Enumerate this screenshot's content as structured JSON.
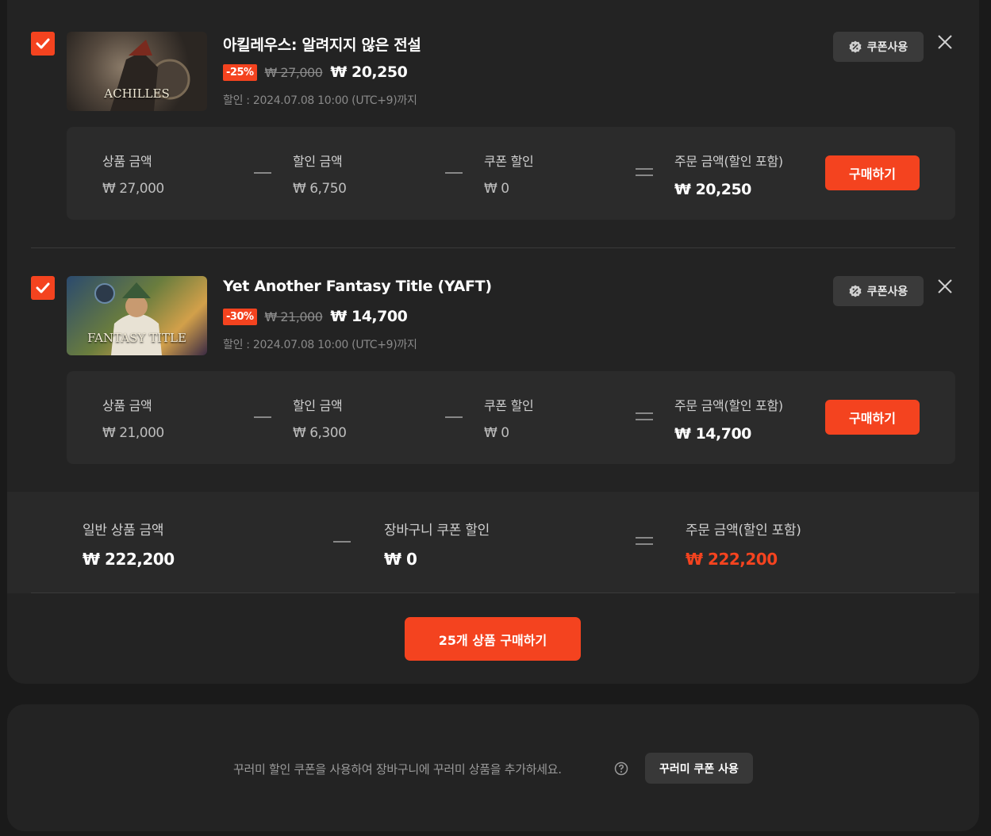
{
  "items": [
    {
      "title": "아킬레우스: 알려지지 않은 전설",
      "thumb_text": "ACHILLES",
      "discount": "-25%",
      "original_price": "₩ 27,000",
      "final_price": "₩ 20,250",
      "period": "할인 : 2024.07.08 10:00 (UTC+9)까지",
      "coupon_label": "쿠폰사용",
      "breakdown": {
        "product_label": "상품 금액",
        "product_value": "₩ 27,000",
        "discount_label": "할인 금액",
        "discount_value": "₩ 6,750",
        "coupon_label": "쿠폰 할인",
        "coupon_value": "₩ 0",
        "order_label": "주문 금액(할인 포함)",
        "order_value": "₩ 20,250"
      },
      "buy_label": "구매하기"
    },
    {
      "title": "Yet Another Fantasy Title (YAFT)",
      "thumb_text": "FANTASY TITLE",
      "discount": "-30%",
      "original_price": "₩ 21,000",
      "final_price": "₩ 14,700",
      "period": "할인 : 2024.07.08 10:00 (UTC+9)까지",
      "coupon_label": "쿠폰사용",
      "breakdown": {
        "product_label": "상품 금액",
        "product_value": "₩ 21,000",
        "discount_label": "할인 금액",
        "discount_value": "₩ 6,300",
        "coupon_label": "쿠폰 할인",
        "coupon_value": "₩ 0",
        "order_label": "주문 금액(할인 포함)",
        "order_value": "₩ 14,700"
      },
      "buy_label": "구매하기"
    }
  ],
  "summary": {
    "general_label": "일반 상품 금액",
    "general_value": "₩ 222,200",
    "cart_coupon_label": "장바구니 쿠폰 할인",
    "cart_coupon_value": "₩ 0",
    "order_label": "주문 금액(할인 포함)",
    "order_value": "₩ 222,200"
  },
  "purchase_all_label": "25개 상품 구매하기",
  "kkurami": {
    "text": "꾸러미 할인 쿠폰을 사용하여 장바구니에 꾸러미 상품을 추가하세요.",
    "button_label": "꾸러미 쿠폰 사용"
  },
  "colors": {
    "accent": "#f4431f",
    "panel": "#232323",
    "background": "#1a1a1a"
  }
}
